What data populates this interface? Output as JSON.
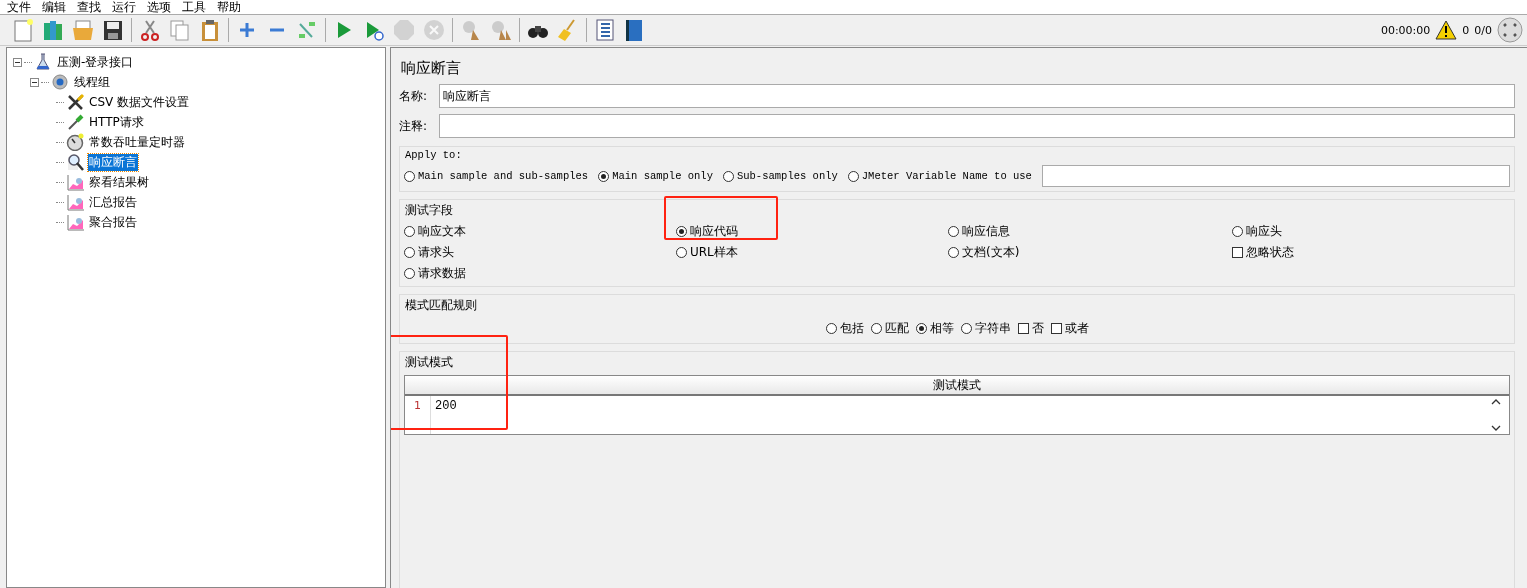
{
  "menu": [
    "文件",
    "编辑",
    "查找",
    "运行",
    "选项",
    "工具",
    "帮助"
  ],
  "toolbar": [
    {
      "disabled": false
    },
    {
      "disabled": false
    },
    {
      "disabled": false
    },
    {
      "disabled": false
    },
    {
      "disabled": false
    },
    {
      "disabled": false
    },
    {
      "disabled": false
    },
    {
      "disabled": false
    },
    {
      "disabled": false
    },
    {
      "disabled": false
    },
    {
      "disabled": false
    },
    {
      "disabled": false
    },
    {
      "disabled": true
    },
    {
      "disabled": true
    },
    {
      "disabled": false
    },
    {
      "disabled": false
    },
    {
      "disabled": false
    },
    {
      "disabled": false
    },
    {
      "disabled": false
    },
    {
      "disabled": false
    }
  ],
  "status": {
    "time": "00:00:00",
    "warnings": "0",
    "threads": "0/0"
  },
  "tree": [
    {
      "label": "压测-登录接口",
      "selected": false,
      "children": [
        {
          "label": "线程组",
          "selected": false,
          "children": [
            {
              "label": "CSV 数据文件设置",
              "selected": false
            },
            {
              "label": "HTTP请求",
              "selected": false
            },
            {
              "label": "常数吞吐量定时器",
              "selected": false
            },
            {
              "label": "响应断言",
              "selected": true
            },
            {
              "label": "察看结果树",
              "selected": false
            },
            {
              "label": "汇总报告",
              "selected": false
            },
            {
              "label": "聚合报告",
              "selected": false
            }
          ]
        }
      ]
    }
  ],
  "panel": {
    "title": "响应断言",
    "name": {
      "label": "名称:",
      "value": "响应断言"
    },
    "comment": {
      "label": "注释:"
    },
    "apply_to": {
      "legend": "Apply to:",
      "options": [
        {
          "label": "Main sample and sub-samples",
          "selected": false
        },
        {
          "label": "Main sample only",
          "selected": true
        },
        {
          "label": "Sub-samples only",
          "selected": false
        },
        {
          "label": "JMeter Variable Name to use",
          "selected": false
        }
      ]
    },
    "test_field": {
      "legend": "测试字段",
      "options": [
        {
          "kind": "radio",
          "label": "响应文本",
          "selected": false,
          "highlighted": false
        },
        {
          "kind": "radio",
          "label": "响应代码",
          "selected": true,
          "highlighted": true
        },
        {
          "kind": "radio",
          "label": "响应信息",
          "selected": false,
          "highlighted": false
        },
        {
          "kind": "radio",
          "label": "响应头",
          "selected": false,
          "highlighted": false
        },
        {
          "kind": "radio",
          "label": "请求头",
          "selected": false,
          "highlighted": false
        },
        {
          "kind": "radio",
          "label": "URL样本",
          "selected": false,
          "highlighted": false
        },
        {
          "kind": "radio",
          "label": "文档(文本)",
          "selected": false,
          "highlighted": false
        },
        {
          "kind": "checkbox",
          "label": "忽略状态",
          "checked": false,
          "highlighted": false
        },
        {
          "kind": "radio",
          "label": "请求数据",
          "selected": false,
          "highlighted": false
        }
      ]
    },
    "pattern_rules": {
      "legend": "模式匹配规则",
      "options": [
        {
          "kind": "radio",
          "label": "包括",
          "selected": false
        },
        {
          "kind": "radio",
          "label": "匹配",
          "selected": false
        },
        {
          "kind": "radio",
          "label": "相等",
          "selected": true
        },
        {
          "kind": "radio",
          "label": "字符串",
          "selected": false
        },
        {
          "kind": "checkbox",
          "label": "否",
          "checked": false
        },
        {
          "kind": "checkbox",
          "label": "或者",
          "checked": false
        }
      ]
    },
    "test_patterns": {
      "legend": "测试模式",
      "highlighted": true,
      "column": "测试模式",
      "rows": [
        {
          "line": "1",
          "value": "200"
        }
      ]
    }
  }
}
